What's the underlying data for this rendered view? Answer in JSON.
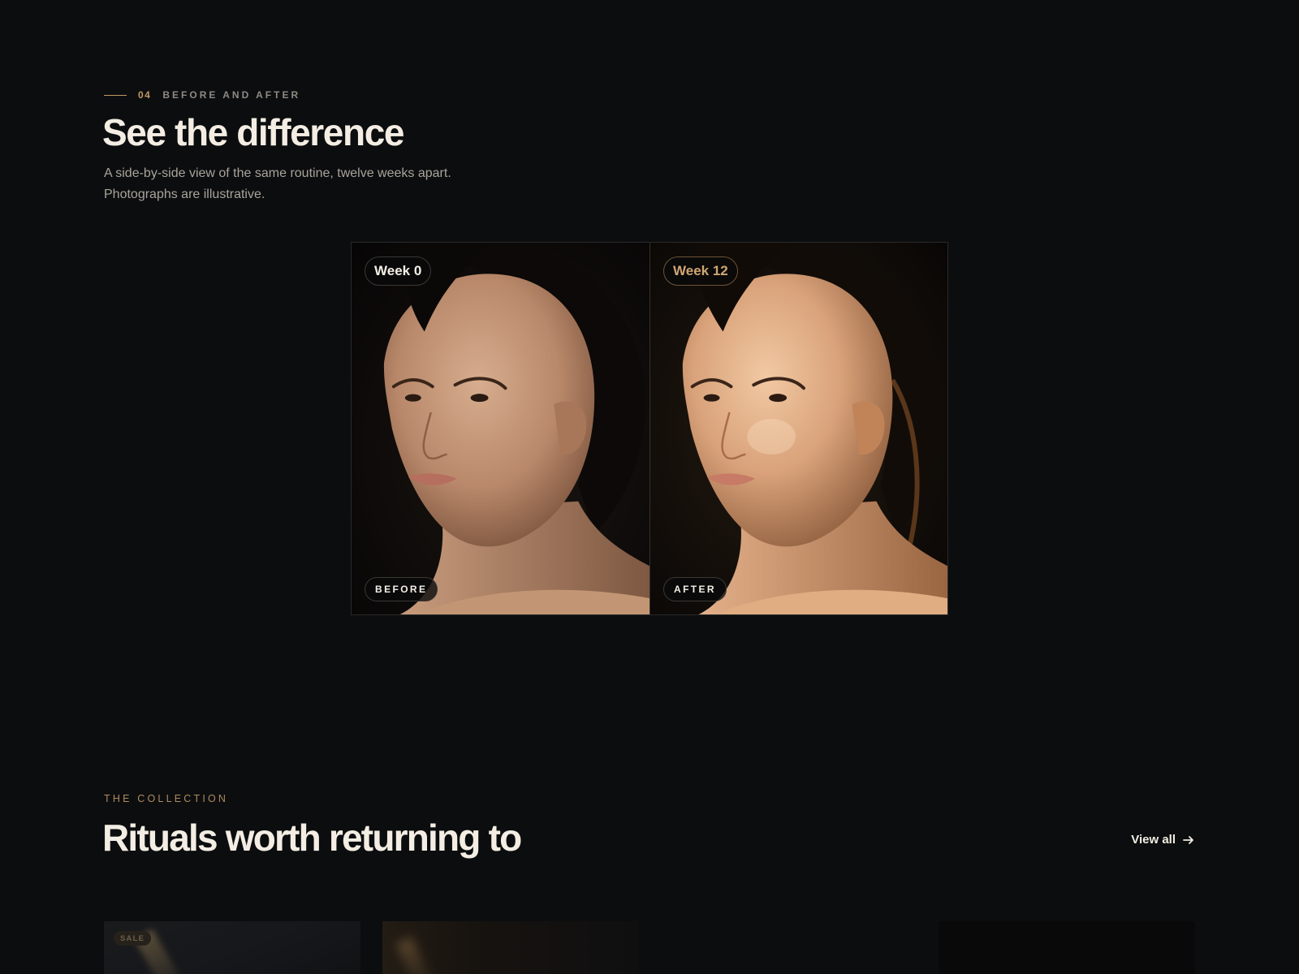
{
  "section": {
    "number": "04",
    "eyebrow": "BEFORE AND AFTER",
    "title": "See the difference",
    "description": "A side-by-side view of the same routine, twelve weeks apart. Photographs are illustrative."
  },
  "comparison": {
    "before": {
      "week_label": "Week 0",
      "tag": "BEFORE"
    },
    "after": {
      "week_label": "Week 12",
      "tag": "AFTER"
    }
  },
  "collection": {
    "eyebrow": "THE COLLECTION",
    "title": "Rituals worth returning to",
    "view_all_label": "View all",
    "cards": [
      {
        "badge": "SALE"
      },
      {},
      {},
      {}
    ]
  },
  "colors": {
    "background": "#0c0d0f",
    "accent_gold": "#c29866",
    "text_primary": "#f3ede3",
    "text_muted": "#a9a49b"
  },
  "icons": {
    "view_all": "arrow-right-icon"
  }
}
